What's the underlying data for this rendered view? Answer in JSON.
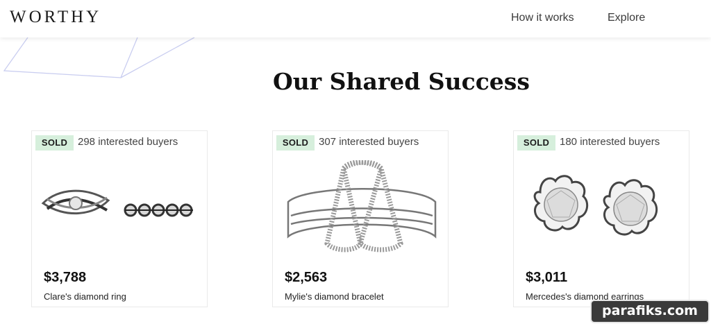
{
  "header": {
    "logo": "WORTHY",
    "nav": [
      {
        "label": "How it works"
      },
      {
        "label": "Explore"
      }
    ]
  },
  "section": {
    "title": "Our Shared Success"
  },
  "cards": [
    {
      "badge": "SOLD",
      "buyers": "298 interested buyers",
      "price": "$3,788",
      "name": "Clare's diamond ring",
      "image": "diamond-ring"
    },
    {
      "badge": "SOLD",
      "buyers": "307 interested buyers",
      "price": "$2,563",
      "name": "Mylie's diamond bracelet",
      "image": "diamond-bracelet"
    },
    {
      "badge": "SOLD",
      "buyers": "180 interested buyers",
      "price": "$3,011",
      "name": "Mercedes's diamond earrings",
      "image": "diamond-earrings"
    }
  ],
  "watermark": "parafiks.com",
  "colors": {
    "sold_badge_bg": "#d6efdc",
    "decoration_line": "#c9cdf0"
  }
}
